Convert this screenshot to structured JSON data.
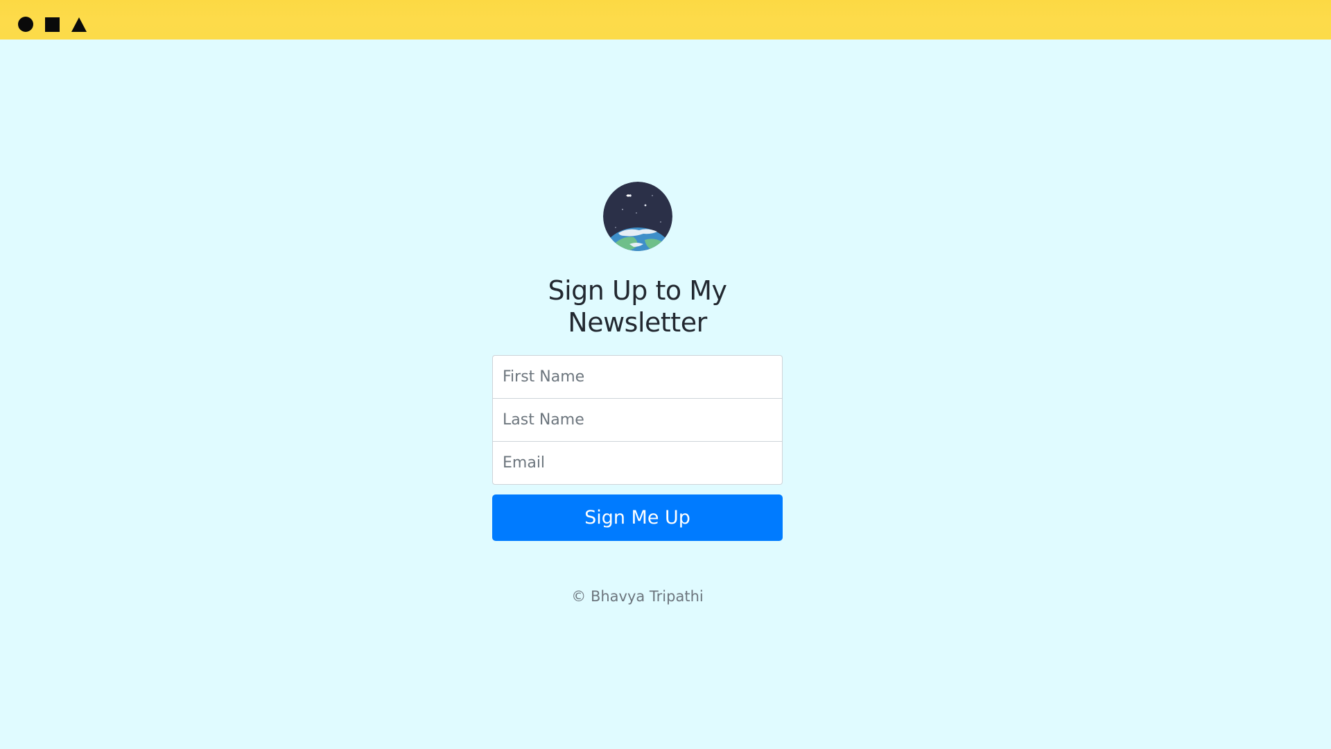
{
  "topbar": {
    "icons": [
      "circle-icon",
      "square-icon",
      "triangle-icon"
    ],
    "color": "#fddb4a"
  },
  "logo": {
    "icon": "earth-space-icon"
  },
  "heading": {
    "line1": "Sign Up to My",
    "line2": "Newsletter"
  },
  "form": {
    "first_name_placeholder": "First Name",
    "last_name_placeholder": "Last Name",
    "email_placeholder": "Email",
    "submit_label": "Sign Me Up"
  },
  "footer": {
    "copyright": "© Bhavya Tripathi"
  },
  "colors": {
    "background": "#e0fbff",
    "accent": "#007bff",
    "heading": "#222830"
  }
}
